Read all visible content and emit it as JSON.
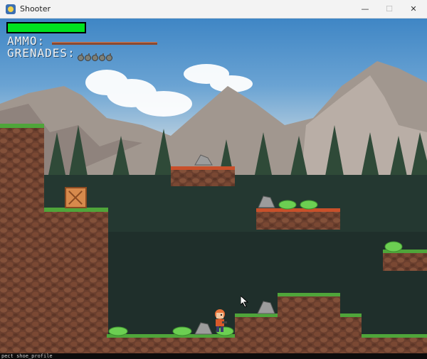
{
  "terminal": {
    "bottom_text": "pect shoe_profile"
  },
  "window": {
    "title": "Shooter",
    "minimize_glyph": "—",
    "maximize_glyph": "☐",
    "close_glyph": "✕"
  },
  "hud": {
    "health_fraction": 1.0,
    "ammo_label": "AMMO:",
    "grenades_label": "GRENADES:",
    "grenade_count": 5,
    "colors": {
      "health": "#00e21f",
      "ammo": "#8b4a31"
    }
  },
  "scene": {
    "icons": [
      "crate-icon",
      "player-icon",
      "rock-icon",
      "bush-icon",
      "mouse-cursor-icon"
    ]
  }
}
